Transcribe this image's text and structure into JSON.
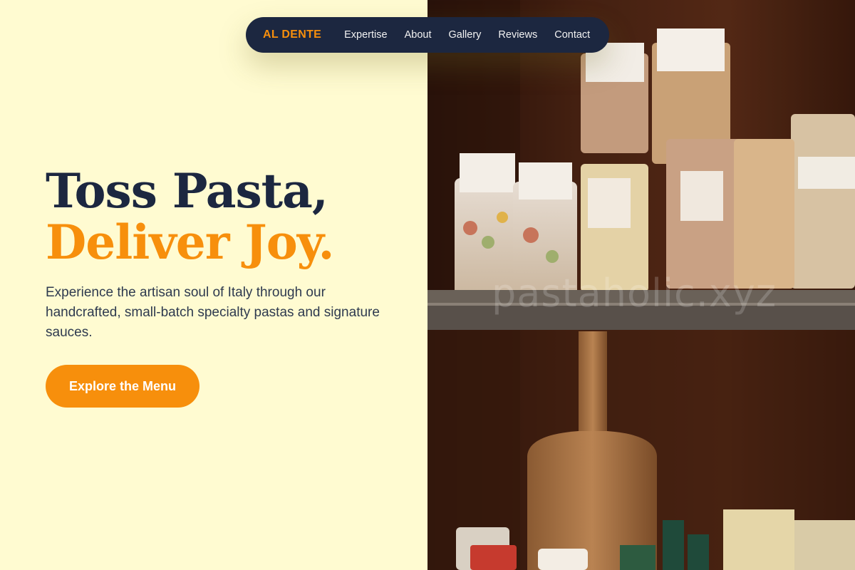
{
  "nav": {
    "brand": "AL DENTE",
    "links": [
      "Expertise",
      "About",
      "Gallery",
      "Reviews",
      "Contact"
    ]
  },
  "hero": {
    "headline_line1": "Toss Pasta,",
    "headline_line2": "Deliver Joy.",
    "lead": "Experience the artisan soul of Italy through our handcrafted, small-batch specialty pastas and signature sauces.",
    "cta": "Explore the Menu"
  },
  "image": {
    "watermark": "pastaholic.xyz"
  },
  "colors": {
    "background": "#fffbd1",
    "navy": "#1c2740",
    "accent": "#f78f0c"
  }
}
